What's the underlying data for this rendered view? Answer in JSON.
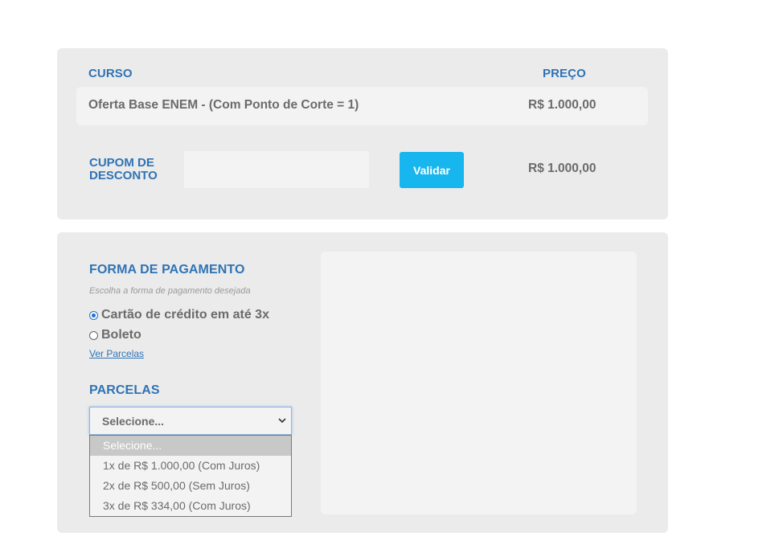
{
  "course": {
    "header_course": "CURSO",
    "header_price": "PREÇO",
    "name": "Oferta Base ENEM - (Com Ponto de Corte = 1)",
    "price": "R$ 1.000,00"
  },
  "coupon": {
    "label_line1": "CUPOM DE",
    "label_line2": "DESCONTO",
    "value": "",
    "button_label": "Validar",
    "total": "R$ 1.000,00"
  },
  "payment": {
    "title": "FORMA DE PAGAMENTO",
    "subtitle": "Escolha a forma de pagamento desejada",
    "options": [
      {
        "label": "Cartão de crédito em até 3x",
        "checked": true
      },
      {
        "label": "Boleto",
        "checked": false
      }
    ],
    "link": "Ver Parcelas"
  },
  "installments": {
    "title": "PARCELAS",
    "selected": "Selecione...",
    "options": [
      "Selecione...",
      "1x de R$ 1.000,00 (Com Juros)",
      "2x de R$ 500,00 (Sem Juros)",
      "3x de R$ 334,00 (Com Juros)"
    ]
  },
  "colors": {
    "accent_blue": "#2f73b5",
    "button_blue": "#17b6ee",
    "panel_bg": "#ebebeb"
  }
}
